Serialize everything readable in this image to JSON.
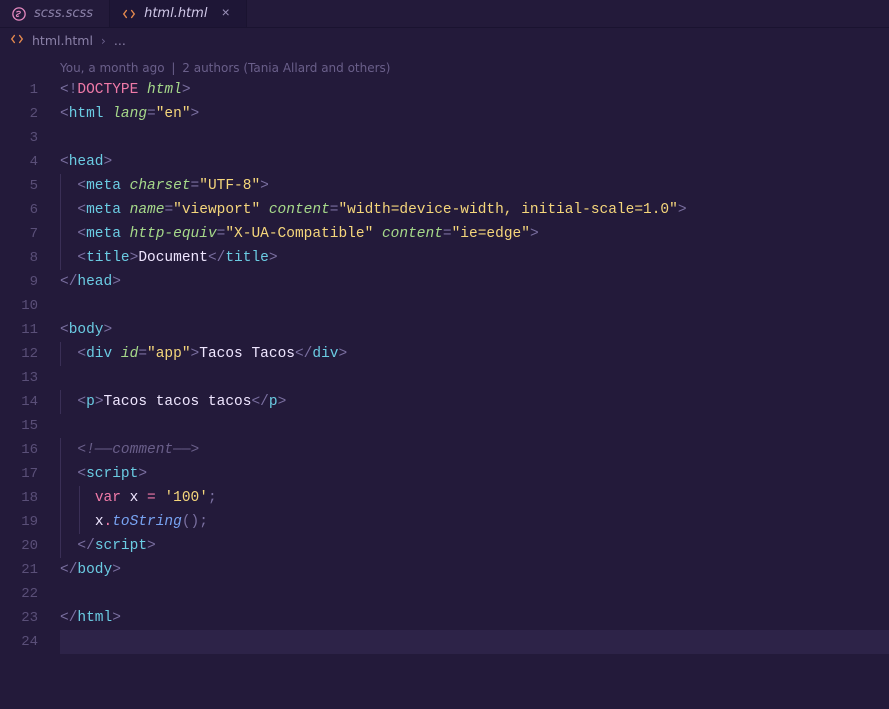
{
  "tabs": [
    {
      "icon": "sass",
      "label": "scss.scss",
      "active": false,
      "close": false
    },
    {
      "icon": "html",
      "label": "html.html",
      "active": true,
      "close": true
    }
  ],
  "breadcrumb": {
    "file": "html.html",
    "ellipsis": "..."
  },
  "codelens": {
    "author": "You, a month ago",
    "sep": "|",
    "authors": "2 authors (Tania Allard and others)"
  },
  "lines": [
    1,
    2,
    3,
    4,
    5,
    6,
    7,
    8,
    9,
    10,
    11,
    12,
    13,
    14,
    15,
    16,
    17,
    18,
    19,
    20,
    21,
    22,
    23,
    24
  ],
  "code": {
    "l1": {
      "doctype": "DOCTYPE",
      "html": "html"
    },
    "l2": {
      "tag": "html",
      "attr": "lang",
      "val": "\"en\""
    },
    "l4": {
      "tag": "head"
    },
    "l5": {
      "tag": "meta",
      "attr": "charset",
      "val": "\"UTF-8\""
    },
    "l6": {
      "tag": "meta",
      "a1": "name",
      "v1": "\"viewport\"",
      "a2": "content",
      "v2": "\"width=device-width, initial-scale=1.0\""
    },
    "l7": {
      "tag": "meta",
      "a1": "http-equiv",
      "v1": "\"X-UA-Compatible\"",
      "a2": "content",
      "v2": "\"ie=edge\""
    },
    "l8": {
      "tag": "title",
      "text": "Document"
    },
    "l9": {
      "tag": "head"
    },
    "l11": {
      "tag": "body"
    },
    "l12": {
      "tag": "div",
      "attr": "id",
      "val": "\"app\"",
      "text": "Tacos Tacos"
    },
    "l14": {
      "tag": "p",
      "text": "Tacos tacos tacos"
    },
    "l16": {
      "comment": "<!——comment——>"
    },
    "l17": {
      "tag": "script"
    },
    "l18": {
      "kw": "var",
      "name": "x",
      "val": "'100'"
    },
    "l19": {
      "name": "x",
      "fn": "toString"
    },
    "l20": {
      "tag": "script"
    },
    "l21": {
      "tag": "body"
    },
    "l23": {
      "tag": "html"
    }
  }
}
